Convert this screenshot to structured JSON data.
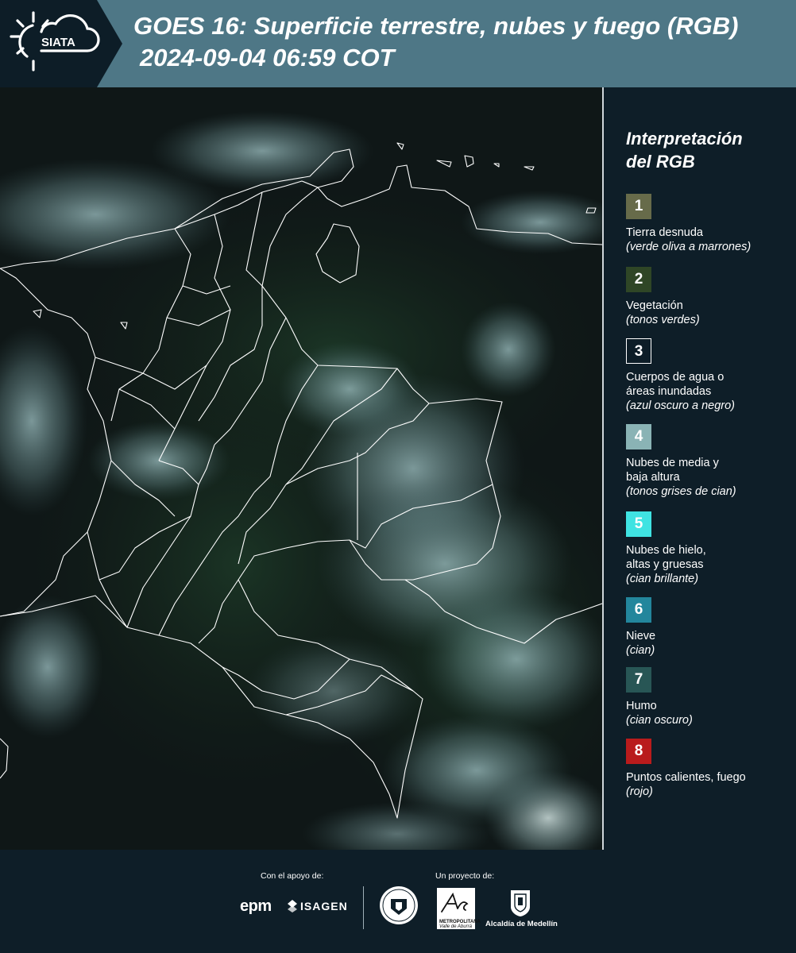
{
  "header": {
    "logo_text": "SIATA",
    "title": "GOES 16: Superficie terrestre, nubes y fuego (RGB)",
    "timestamp": "2024-09-04 06:59 COT"
  },
  "legend": {
    "title_line1": "Interpretación",
    "title_line2": "del RGB",
    "items": [
      {
        "number": "1",
        "color": "#676b4a",
        "label": "Tierra desnuda",
        "note": "(verde oliva a marrones)"
      },
      {
        "number": "2",
        "color": "#2f4626",
        "label": "Vegetación",
        "note": "(tonos verdes)"
      },
      {
        "number": "3",
        "color": "#0d1d27",
        "label_lines": [
          "Cuerpos de agua o",
          "áreas inundadas"
        ],
        "note": "(azul oscuro a negro)"
      },
      {
        "number": "4",
        "color": "#8ab3b5",
        "label_lines": [
          "Nubes de media y",
          "baja altura"
        ],
        "note": "(tonos grises de cian)"
      },
      {
        "number": "5",
        "color": "#3fe3e2",
        "label_lines": [
          "Nubes de hielo,",
          "altas y gruesas"
        ],
        "note": "(cian brillante)"
      },
      {
        "number": "6",
        "color": "#23869c",
        "label": "Nieve",
        "note": "(cian)"
      },
      {
        "number": "7",
        "color": "#285655",
        "label": "Humo",
        "note": "(cian oscuro)"
      },
      {
        "number": "8",
        "color": "#b91b1c",
        "label": "Puntos calientes, fuego",
        "note": "(rojo)"
      }
    ]
  },
  "footer": {
    "support_label": "Con el apoyo de:",
    "project_label": "Un proyecto de:",
    "sponsor_epm": "epm",
    "sponsor_isagen": "ISAGEN",
    "area_metro": "METROPOLITANA",
    "area_sub": "Valle de Aburrá",
    "alcaldia": "Alcaldía de Medellín"
  },
  "colors": {
    "header_band": "#4e7786",
    "background": "#0e1e28",
    "border_lines": "#ffffff"
  }
}
